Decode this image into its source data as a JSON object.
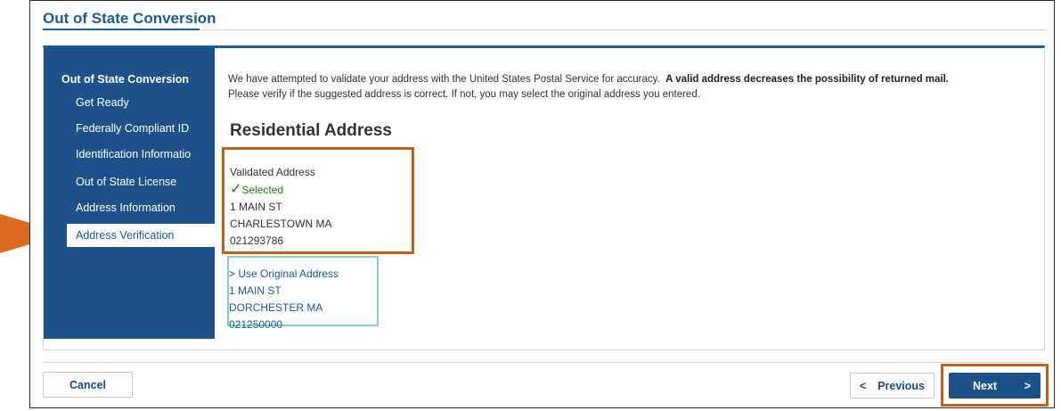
{
  "header": {
    "title": "Out of State Conversion"
  },
  "sidebar": {
    "header": "Out of State Conversion",
    "items": [
      {
        "label": "Get Ready"
      },
      {
        "label": "Federally Compliant ID"
      },
      {
        "label": "Identification Informatio"
      },
      {
        "label": "Out of State License"
      },
      {
        "label": "Address Information"
      },
      {
        "label": "Address Verification",
        "active": true
      }
    ]
  },
  "main": {
    "intro": "We have attempted to validate your address with the United States Postal Service for accuracy.",
    "intro_bold": "A valid address decreases the possibility of returned mail.",
    "intro_line2": "Please verify if the suggested address is correct.  If not, you may select the original address you entered.",
    "section_title": "Residential Address",
    "validated": {
      "heading": "Validated Address",
      "selected_label": "Selected",
      "line1": "1 MAIN ST",
      "line2": "CHARLESTOWN MA",
      "line3": "021293786"
    },
    "original": {
      "link": "> Use Original Address",
      "line1": "1 MAIN ST",
      "line2": "DORCHESTER MA 021250000"
    }
  },
  "footer": {
    "cancel_label": "Cancel",
    "previous_label": "Previous",
    "previous_icon": "<",
    "next_label": "Next",
    "next_icon": ">"
  },
  "colors": {
    "brand": "#1c5289",
    "highlight": "#c5601b",
    "selected": "#1f7a1f",
    "original_border": "#7fd3c0"
  }
}
